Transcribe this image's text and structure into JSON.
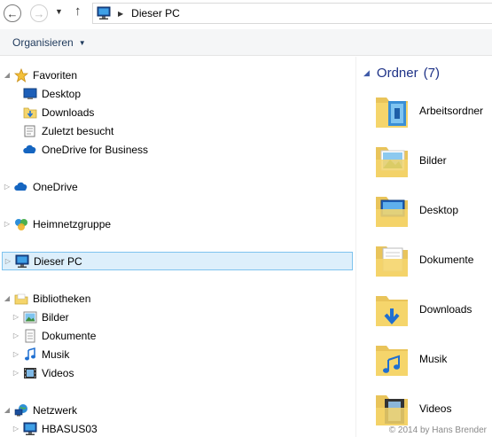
{
  "address": {
    "location": "Dieser PC"
  },
  "commandbar": {
    "organize_label": "Organisieren"
  },
  "navtree": {
    "favorites": {
      "label": "Favoriten",
      "items": [
        {
          "label": "Desktop"
        },
        {
          "label": "Downloads"
        },
        {
          "label": "Zuletzt besucht"
        },
        {
          "label": "OneDrive for Business"
        }
      ]
    },
    "onedrive": {
      "label": "OneDrive"
    },
    "homegroup": {
      "label": "Heimnetzgruppe"
    },
    "thispc": {
      "label": "Dieser PC"
    },
    "libraries": {
      "label": "Bibliotheken",
      "items": [
        {
          "label": "Bilder"
        },
        {
          "label": "Dokumente"
        },
        {
          "label": "Musik"
        },
        {
          "label": "Videos"
        }
      ]
    },
    "network": {
      "label": "Netzwerk",
      "items": [
        {
          "label": "HBASUS03"
        }
      ]
    }
  },
  "content": {
    "group_title": "Ordner",
    "group_count": "(7)",
    "folders": [
      {
        "label": "Arbeitsordner",
        "icon": "work-folders-icon"
      },
      {
        "label": "Bilder",
        "icon": "pictures-folder-icon"
      },
      {
        "label": "Desktop",
        "icon": "desktop-folder-icon"
      },
      {
        "label": "Dokumente",
        "icon": "documents-folder-icon"
      },
      {
        "label": "Downloads",
        "icon": "downloads-folder-icon"
      },
      {
        "label": "Musik",
        "icon": "music-folder-icon"
      },
      {
        "label": "Videos",
        "icon": "videos-folder-icon"
      }
    ]
  },
  "watermark": "© 2014 by Hans Brender",
  "colors": {
    "group_header": "#1e3287",
    "selection_bg": "#ddeffb",
    "selection_border": "#7ec3ee",
    "folder_yellow": "#f5d56b"
  }
}
